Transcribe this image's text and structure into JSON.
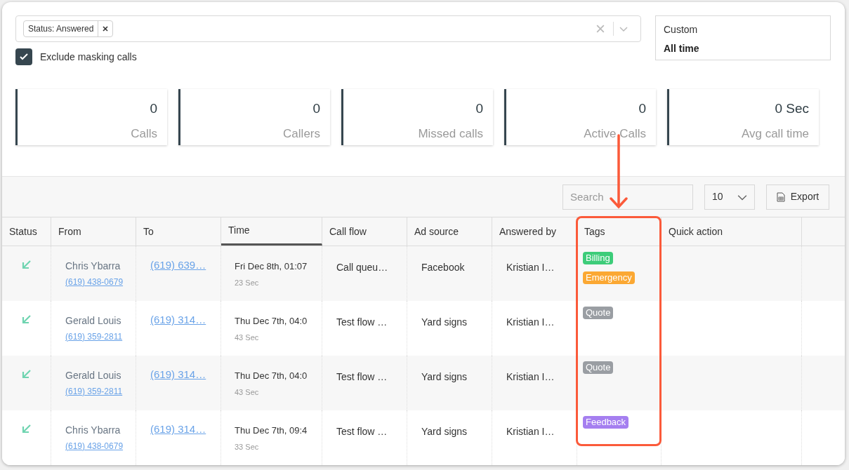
{
  "filter": {
    "chips": [
      "Status: Answered"
    ],
    "exclude_masking": {
      "label": "Exclude masking calls",
      "checked": true
    }
  },
  "date_range": {
    "label": "Custom",
    "value": "All time"
  },
  "stats": [
    {
      "value": "0",
      "label": "Calls"
    },
    {
      "value": "0",
      "label": "Callers"
    },
    {
      "value": "0",
      "label": "Missed calls"
    },
    {
      "value": "0",
      "label": "Active Calls"
    },
    {
      "value": "0 Sec",
      "label": "Avg call time"
    }
  ],
  "toolbar": {
    "search_placeholder": "Search",
    "page_size": "10",
    "export": "Export"
  },
  "table": {
    "columns": [
      {
        "label": "Status",
        "selected": false
      },
      {
        "label": "From",
        "selected": false
      },
      {
        "label": "To",
        "selected": false
      },
      {
        "label": "Time",
        "selected": true
      },
      {
        "label": "Call flow",
        "selected": false
      },
      {
        "label": "Ad source",
        "selected": false
      },
      {
        "label": "Answered by",
        "selected": false
      },
      {
        "label": "Tags",
        "selected": false
      },
      {
        "label": "Quick action",
        "selected": false
      }
    ],
    "rows": [
      {
        "from_name": "Chris Ybarra",
        "from_number": "(619) 438-0679",
        "to": "(619) 639…",
        "time": "Fri Dec 8th, 01:07",
        "duration": "23 Sec",
        "call_flow": "Call queu…",
        "ad_source": "Facebook",
        "answered_by": "Kristian I…",
        "tags": [
          {
            "label": "Billing",
            "color": "#3dcc79"
          },
          {
            "label": "Emergency",
            "color": "#fba833"
          }
        ]
      },
      {
        "from_name": "Gerald Louis",
        "from_number": "(619) 359-2811",
        "to": "(619) 314…",
        "time": "Thu Dec 7th, 04:0",
        "duration": "43 Sec",
        "call_flow": "Test flow …",
        "ad_source": "Yard signs",
        "answered_by": "Kristian I…",
        "tags": [
          {
            "label": "Quote",
            "color": "#9a9ea3"
          }
        ]
      },
      {
        "from_name": "Gerald Louis",
        "from_number": "(619) 359-2811",
        "to": "(619) 314…",
        "time": "Thu Dec 7th, 04:0",
        "duration": "43 Sec",
        "call_flow": "Test flow …",
        "ad_source": "Yard signs",
        "answered_by": "Kristian I…",
        "tags": [
          {
            "label": "Quote",
            "color": "#9a9ea3"
          }
        ]
      },
      {
        "from_name": "Chris Ybarra",
        "from_number": "(619) 438-0679",
        "to": "(619) 314…",
        "time": "Thu Dec 7th, 09:4",
        "duration": "33 Sec",
        "call_flow": "Test flow …",
        "ad_source": "Yard signs",
        "answered_by": "Kristian I…",
        "tags": [
          {
            "label": "Feedback",
            "color": "#a57ff0"
          }
        ]
      }
    ]
  }
}
